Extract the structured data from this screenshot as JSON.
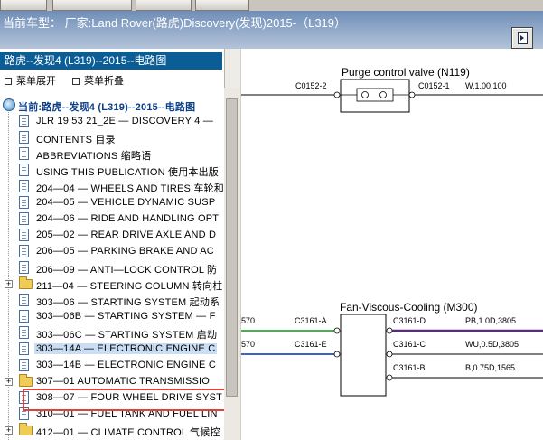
{
  "header": {
    "vehicle_label": "当前车型：",
    "vehicle_value": "厂家:Land Rover(路虎)Discovery(发现)2015-（L319）"
  },
  "panel": {
    "title": "路虎--发现4 (L319)--2015--电路图",
    "expand_label": "菜单展开",
    "collapse_label": "菜单折叠"
  },
  "tree": {
    "root": "当前:路虎--发现4 (L319)--2015--电路图",
    "items": [
      {
        "label": "JLR 19 53 21_2E — DISCOVERY 4 —",
        "type": "doc"
      },
      {
        "label": "CONTENTS 目录",
        "type": "doc"
      },
      {
        "label": "ABBREVIATIONS 缩略语",
        "type": "doc"
      },
      {
        "label": "USING THIS PUBLICATION 使用本出版",
        "type": "doc"
      },
      {
        "label": "204—04 — WHEELS AND TIRES 车轮和",
        "type": "doc"
      },
      {
        "label": "204—05 — VEHICLE DYNAMIC SUSP",
        "type": "doc"
      },
      {
        "label": "204—06 — RIDE AND HANDLING OPT",
        "type": "doc"
      },
      {
        "label": "205—02 — REAR DRIVE AXLE AND D",
        "type": "doc"
      },
      {
        "label": "206—05 — PARKING BRAKE AND AC",
        "type": "doc"
      },
      {
        "label": "206—09 — ANTI—LOCK CONTROL 防",
        "type": "doc"
      },
      {
        "label": "211—04 — STEERING COLUMN 转向柱",
        "type": "folder"
      },
      {
        "label": "303—06 — STARTING SYSTEM 起动系",
        "type": "doc"
      },
      {
        "label": "303—06B — STARTING SYSTEM — F",
        "type": "doc"
      },
      {
        "label": "303—06C — STARTING SYSTEM 启动",
        "type": "doc"
      },
      {
        "label": "303—14A — ELECTRONIC ENGINE C",
        "type": "doc"
      },
      {
        "label": "303—14B — ELECTRONIC ENGINE C",
        "type": "doc"
      },
      {
        "label": "307—01 AUTOMATIC TRANSMISSIO",
        "type": "folder"
      },
      {
        "label": "308—07 — FOUR WHEEL DRIVE SYST",
        "type": "doc"
      },
      {
        "label": "310—01 — FUEL TANK AND FUEL LIN",
        "type": "doc"
      },
      {
        "label": "412—01 — CLIMATE CONTROL 气候控",
        "type": "folder"
      }
    ]
  },
  "diagram": {
    "purge": {
      "title": "Purge control valve (N119)",
      "left_connector": "C0152-2",
      "right_connector": "C0152-1",
      "wire": "W,1.00,100"
    },
    "fan": {
      "title": "Fan-Viscous-Cooling (M300)",
      "left_top": "C3161-A",
      "left_bottom": "C3161-E",
      "right_1": "C3161-D",
      "right_2": "C3161-C",
      "right_3": "C3161-B",
      "wire_1": "PB,1.0D,3805",
      "wire_2": "WU,0.5D,3805",
      "wire_3": "B,0.75D,1565",
      "edge_1": "570",
      "edge_2": "570"
    }
  },
  "colors": {
    "highlight": "#e0413a",
    "panel_title_bg": "#0b5d96",
    "wire_green": "#3fb54a",
    "wire_purple": "#5a2a85",
    "wire_blue": "#3b62c7"
  }
}
